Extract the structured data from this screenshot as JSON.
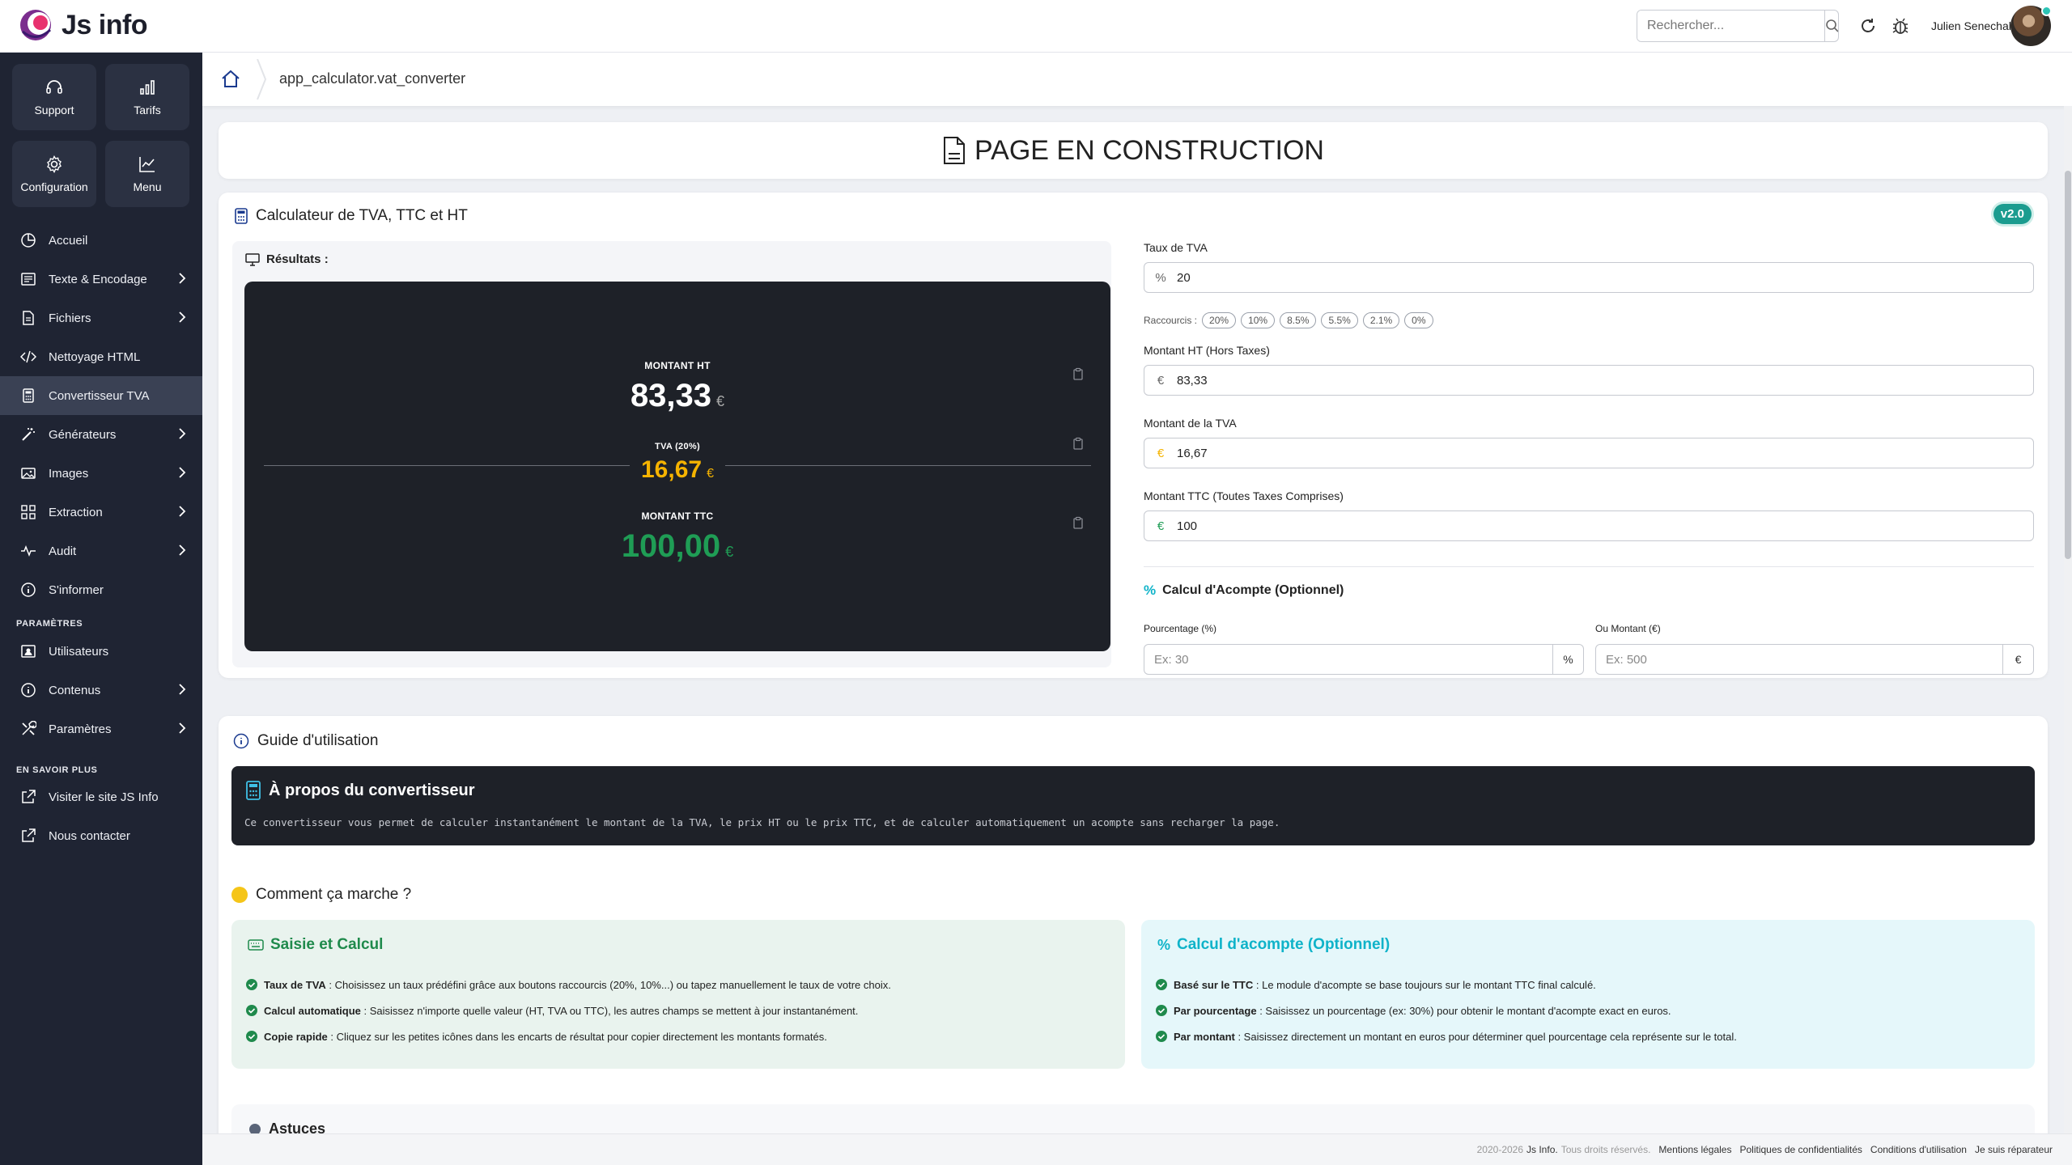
{
  "app": {
    "name": "Js info"
  },
  "header": {
    "search_placeholder": "Rechercher...",
    "user_name": "Julien Senechal"
  },
  "sidebar": {
    "tiles": [
      {
        "label": "Support",
        "icon": "headset-icon"
      },
      {
        "label": "Tarifs",
        "icon": "bar-chart-icon"
      },
      {
        "label": "Configuration",
        "icon": "gear-icon"
      },
      {
        "label": "Menu",
        "icon": "line-chart-icon"
      }
    ],
    "items": [
      {
        "label": "Accueil",
        "icon": "pie-icon",
        "chevron": false
      },
      {
        "label": "Texte & Encodage",
        "icon": "text-icon",
        "chevron": true
      },
      {
        "label": "Fichiers",
        "icon": "file-icon",
        "chevron": true
      },
      {
        "label": "Nettoyage HTML",
        "icon": "code-icon",
        "chevron": false
      },
      {
        "label": "Convertisseur TVA",
        "icon": "calculator-icon",
        "chevron": false,
        "active": true
      },
      {
        "label": "Générateurs",
        "icon": "magic-icon",
        "chevron": true
      },
      {
        "label": "Images",
        "icon": "image-icon",
        "chevron": true
      },
      {
        "label": "Extraction",
        "icon": "grid-icon",
        "chevron": true
      },
      {
        "label": "Audit",
        "icon": "pulse-icon",
        "chevron": true
      },
      {
        "label": "S'informer",
        "icon": "info-icon",
        "chevron": false
      }
    ],
    "section_params": "PARAMÈTRES",
    "params_items": [
      {
        "label": "Utilisateurs",
        "icon": "user-card-icon",
        "chevron": false
      },
      {
        "label": "Contenus",
        "icon": "info-icon",
        "chevron": true
      },
      {
        "label": "Paramètres",
        "icon": "tools-icon",
        "chevron": true
      }
    ],
    "section_more": "EN SAVOIR PLUS",
    "more_items": [
      {
        "label": "Visiter le site JS Info",
        "icon": "external-link-icon"
      },
      {
        "label": "Nous contacter",
        "icon": "external-link-icon"
      }
    ]
  },
  "breadcrumb": {
    "path": "app_calculator.vat_converter"
  },
  "construction": {
    "title": "PAGE EN CONSTRUCTION"
  },
  "calculator": {
    "title": "Calculateur de TVA, TTC et HT",
    "version": "v2.0",
    "results_title": "Résultats :",
    "ht_label": "MONTANT HT",
    "ht_value": "83,33",
    "tva_label": "TVA (20%)",
    "tva_value": "16,67",
    "ttc_label": "MONTANT TTC",
    "ttc_value": "100,00",
    "currency": "€",
    "colors": {
      "ht": "#ffffff",
      "tva": "#f5b301",
      "ttc": "#1f9d55"
    }
  },
  "form": {
    "rate_label": "Taux de TVA",
    "rate_prefix": "%",
    "rate_value": "20",
    "shortcuts_label": "Raccourcis :",
    "shortcuts": [
      "20%",
      "10%",
      "8.5%",
      "5.5%",
      "2.1%",
      "0%"
    ],
    "ht_label": "Montant HT (Hors Taxes)",
    "ht_prefix": "€",
    "ht_value": "83,33",
    "tva_label": "Montant de la TVA",
    "tva_prefix": "€",
    "tva_value": "16,67",
    "ttc_label": "Montant TTC (Toutes Taxes Comprises)",
    "ttc_prefix": "€",
    "ttc_value": "100",
    "acompte_title": "Calcul d'Acompte (Optionnel)",
    "percent_label": "Pourcentage (%)",
    "percent_placeholder": "Ex: 30",
    "percent_suffix": "%",
    "amount_label": "Ou Montant (€)",
    "amount_placeholder": "Ex: 500",
    "amount_suffix": "€"
  },
  "guide": {
    "title": "Guide d'utilisation",
    "about_title": "À propos du convertisseur",
    "about_text": "Ce convertisseur vous permet de calculer instantanément le montant de la TVA, le prix HT ou le prix TTC, et de calculer automatiquement un acompte sans recharger la page.",
    "how_title": "Comment ça marche ?",
    "card1": {
      "title": "Saisie et Calcul",
      "color": "#1f8a4c",
      "bg": "#e9f3ee",
      "items": [
        {
          "bold": "Taux de TVA",
          "text": " : Choisissez un taux prédéfini grâce aux boutons raccourcis (20%, 10%...) ou tapez manuellement le taux de votre choix."
        },
        {
          "bold": "Calcul automatique",
          "text": " : Saisissez n'importe quelle valeur (HT, TVA ou TTC), les autres champs se mettent à jour instantanément."
        },
        {
          "bold": "Copie rapide",
          "text": " : Cliquez sur les petites icônes dans les encarts de résultat pour copier directement les montants formatés."
        }
      ]
    },
    "card2": {
      "title": "Calcul d'acompte (Optionnel)",
      "color": "#0fb3c9",
      "bg": "#e5f7fa",
      "items": [
        {
          "bold": "Basé sur le TTC",
          "text": " : Le module d'acompte se base toujours sur le montant TTC final calculé."
        },
        {
          "bold": "Par pourcentage",
          "text": " : Saisissez un pourcentage (ex: 30%) pour obtenir le montant d'acompte exact en euros."
        },
        {
          "bold": "Par montant",
          "text": " : Saisissez directement un montant en euros pour déterminer quel pourcentage cela représente sur le total."
        }
      ]
    },
    "tips_title": "Astuces"
  },
  "footer": {
    "copyright": "2020-2026",
    "brand": "Js Info.",
    "rights": "Tous droits réservés.",
    "links": [
      "Mentions légales",
      "Politiques de confidentialités",
      "Conditions d'utilisation",
      "Je suis réparateur"
    ]
  }
}
